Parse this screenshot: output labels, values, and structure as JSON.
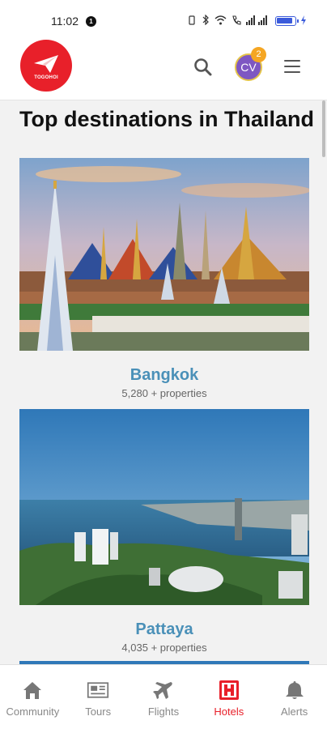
{
  "status_bar": {
    "time": "11:02",
    "notification_count": "1"
  },
  "header": {
    "logo_text": "TOGOHOI",
    "avatar_initials": "CV",
    "avatar_badge": "2",
    "brand_color": "#e8202a"
  },
  "page": {
    "title": "Top destinations in Thailand"
  },
  "destinations": [
    {
      "name": "Bangkok",
      "count": "5,280 + properties"
    },
    {
      "name": "Pattaya",
      "count": "4,035 + properties"
    }
  ],
  "bottom_nav": [
    {
      "label": "Community",
      "icon": "home-icon"
    },
    {
      "label": "Tours",
      "icon": "newspaper-icon"
    },
    {
      "label": "Flights",
      "icon": "airplane-icon"
    },
    {
      "label": "Hotels",
      "icon": "hotel-icon",
      "active": true
    },
    {
      "label": "Alerts",
      "icon": "bell-icon"
    }
  ],
  "colors": {
    "accent": "#e8202a",
    "destination_name": "#4a90b8",
    "avatar": "#7e57c2",
    "badge": "#f5a623"
  }
}
